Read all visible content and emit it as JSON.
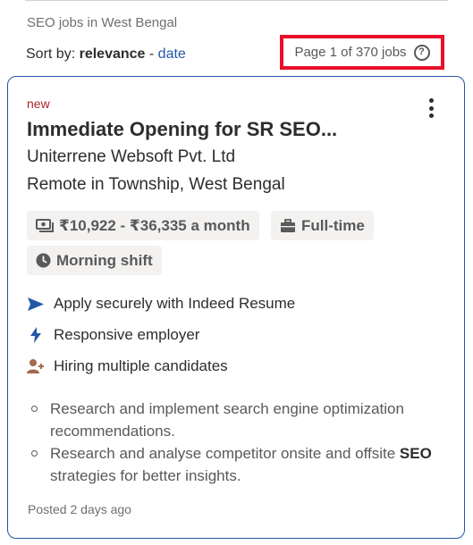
{
  "header": {
    "context": "SEO jobs in West Bengal",
    "sort_prefix": "Sort by:",
    "sort_active": "relevance",
    "sort_separator": "-",
    "sort_alt": "date",
    "page_count": "Page 1 of 370 jobs",
    "help_glyph": "?"
  },
  "job": {
    "badge": "new",
    "title": "Immediate Opening for SR SEO...",
    "company": "Uniterrene Websoft Pvt. Ltd",
    "location": "Remote in Township, West Bengal",
    "salary": "₹10,922 - ₹36,335 a month",
    "job_type": "Full-time",
    "shift": "Morning shift",
    "features": [
      {
        "icon": "send-icon",
        "text": "Apply securely with Indeed Resume",
        "color": "#2557a7"
      },
      {
        "icon": "lightning-icon",
        "text": "Responsive employer",
        "color": "#2557a7"
      },
      {
        "icon": "add-person-icon",
        "text": "Hiring multiple candidates",
        "color": "#a36a4f"
      }
    ],
    "snippet": [
      {
        "before": "Research and implement search engine optimization recommendations.",
        "bold": "",
        "after": ""
      },
      {
        "before": "Research and analyse competitor onsite and offsite ",
        "bold": "SEO",
        "after": " strategies for better insights."
      }
    ],
    "posted": "Posted 2 days ago"
  },
  "colors": {
    "accent": "#2557a7",
    "highlight_border": "#e8102a",
    "new_badge": "#a9252b"
  }
}
